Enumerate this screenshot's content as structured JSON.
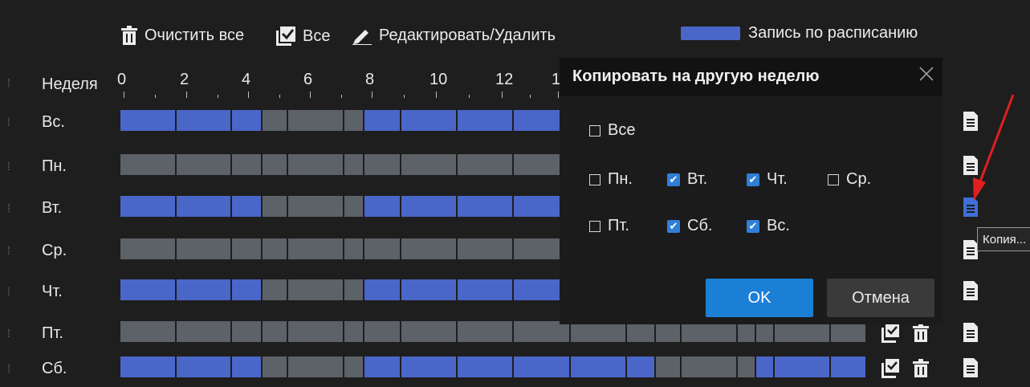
{
  "toolbar": {
    "clear_all": "Очистить все",
    "select_all": "Все",
    "edit_delete": "Редактировать/Удалить",
    "legend_label": "Запись по расписанию",
    "legend_color": "#4a66c8"
  },
  "header": {
    "week_label": "Неделя",
    "hours": [
      "0",
      "2",
      "4",
      "6",
      "8",
      "10",
      "12",
      "1"
    ]
  },
  "days": [
    {
      "label": "Вс."
    },
    {
      "label": "Пн."
    },
    {
      "label": "Вт."
    },
    {
      "label": "Ср."
    },
    {
      "label": "Чт."
    },
    {
      "label": "Пт."
    },
    {
      "label": "Сб."
    }
  ],
  "colors": {
    "recording": "#4a66c8",
    "empty": "#5d6168",
    "accent": "#1c7fd6",
    "arrow": "#e02020"
  },
  "dialog": {
    "title": "Копировать на другую неделю",
    "all_label": "Все",
    "options": [
      {
        "label": "Пн.",
        "checked": false
      },
      {
        "label": "Вт.",
        "checked": true
      },
      {
        "label": "Чт.",
        "checked": true
      },
      {
        "label": "Ср.",
        "checked": false
      },
      {
        "label": "Пт.",
        "checked": false
      },
      {
        "label": "Сб.",
        "checked": true
      },
      {
        "label": "Вс.",
        "checked": true
      }
    ],
    "ok_label": "OK",
    "cancel_label": "Отмена"
  },
  "tooltip": {
    "text": "Копия..."
  }
}
